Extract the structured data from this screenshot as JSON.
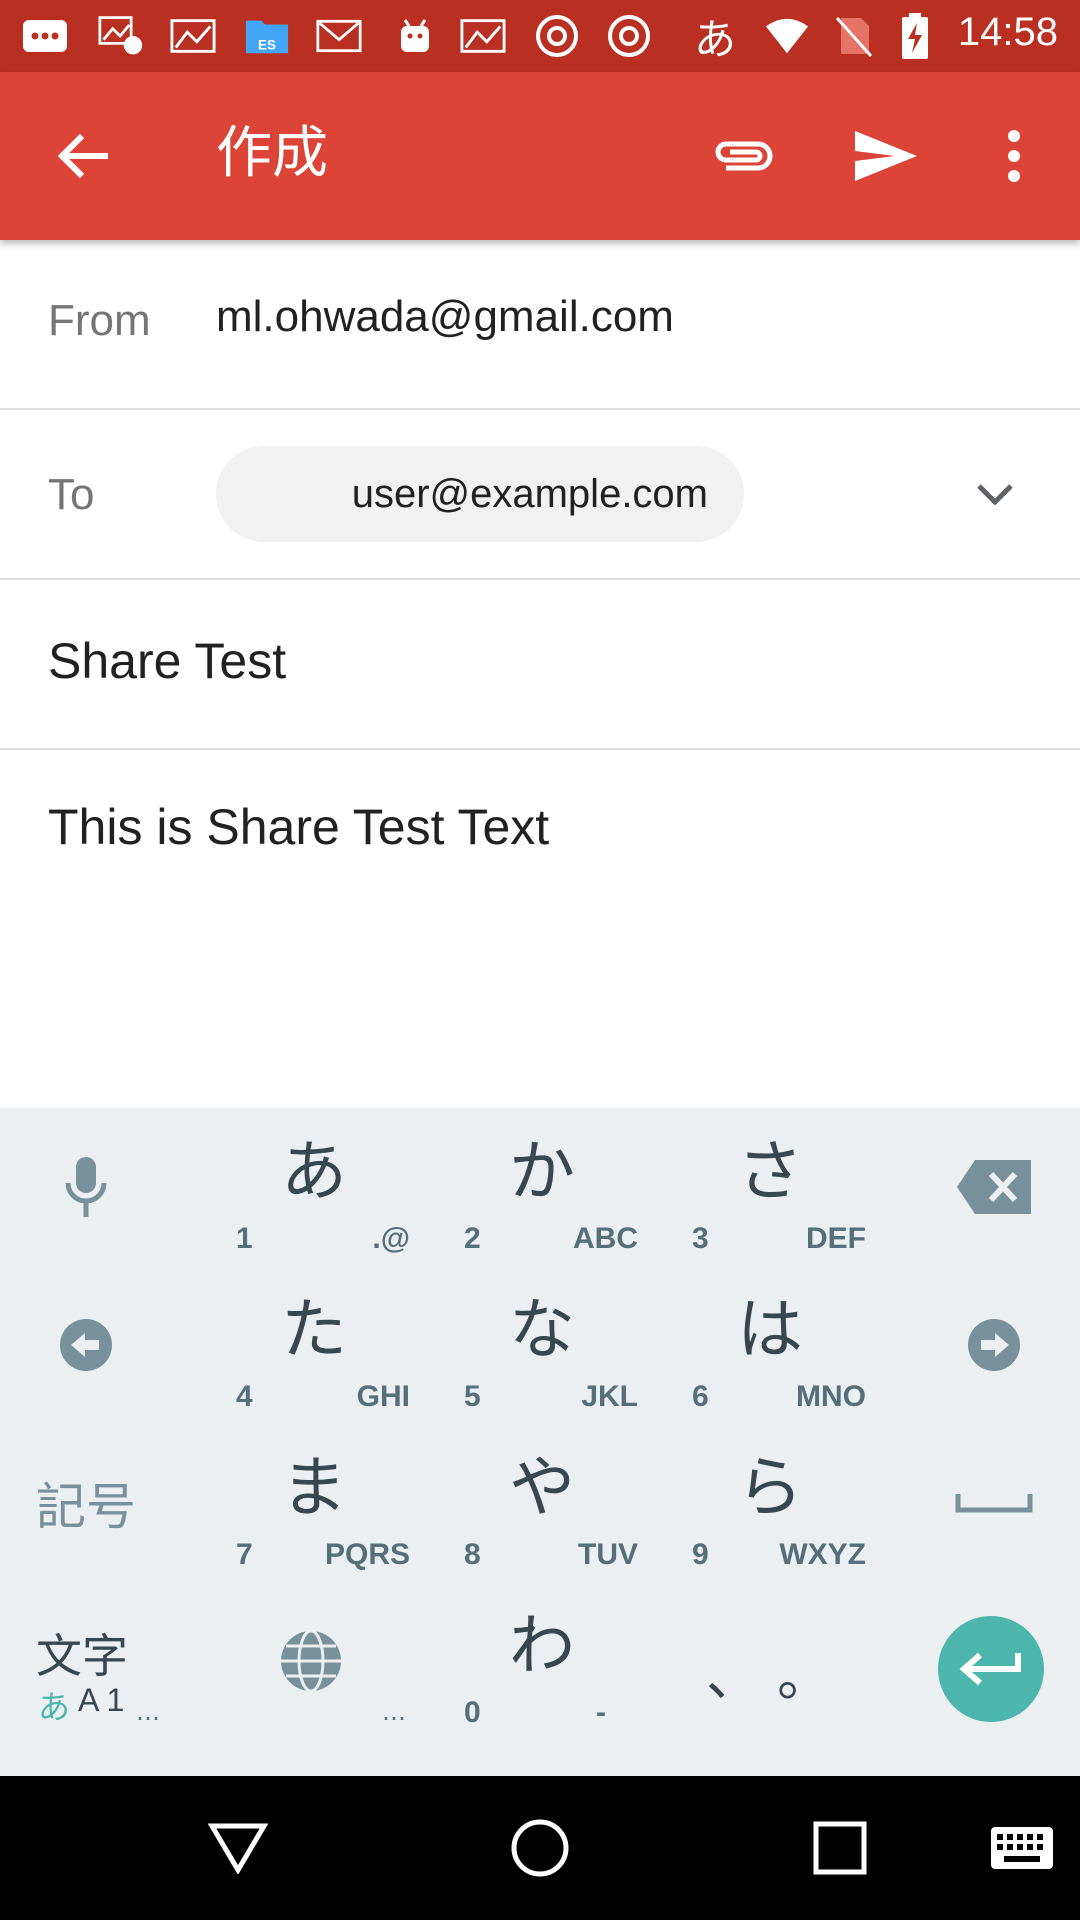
{
  "status_bar": {
    "time": "14:58",
    "ime_indicator": "あ"
  },
  "app_bar": {
    "title": "作成",
    "icons": [
      "arrow-back-icon",
      "attach-icon",
      "send-icon",
      "more-vert-icon"
    ]
  },
  "compose": {
    "from_label": "From",
    "from_value": "ml.ohwada@gmail.com",
    "to_label": "To",
    "to_chip": "user@example.com",
    "subject": "Share Test",
    "body": "This is Share Test Text"
  },
  "keyboard": {
    "keys": [
      {
        "kana": "あ",
        "num": "1",
        "letters": ".@"
      },
      {
        "kana": "か",
        "num": "2",
        "letters": "ABC"
      },
      {
        "kana": "さ",
        "num": "3",
        "letters": "DEF"
      },
      {
        "kana": "た",
        "num": "4",
        "letters": "GHI"
      },
      {
        "kana": "な",
        "num": "5",
        "letters": "JKL"
      },
      {
        "kana": "は",
        "num": "6",
        "letters": "MNO"
      },
      {
        "kana": "ま",
        "num": "7",
        "letters": "PQRS"
      },
      {
        "kana": "や",
        "num": "8",
        "letters": "TUV"
      },
      {
        "kana": "ら",
        "num": "9",
        "letters": "WXYZ"
      },
      {
        "kana": "わ",
        "num": "0",
        "letters": "-"
      }
    ],
    "symbols_label": "記号",
    "mode_label_top": "文字",
    "mode_label_kana": "あ",
    "mode_label_alpha": "A 1",
    "more_dots": "…",
    "punct_label": "、 。",
    "enter_color": "#4db6ac"
  },
  "colors": {
    "app_bar": "#db4437",
    "status_bar": "#b92f22"
  }
}
